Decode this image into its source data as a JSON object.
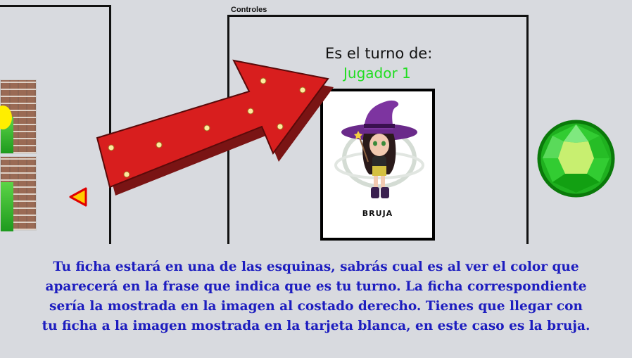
{
  "controls": {
    "title": "Controles",
    "turn_label": "Es el turno de:",
    "current_player": "Jugador 1",
    "player_color": "#22dd22"
  },
  "card": {
    "character": "witch",
    "caption": "BRUJA"
  },
  "board": {
    "nav_icon": "triangle-left-icon",
    "player_token": "green-gem-icon"
  },
  "instructions": {
    "line1": "Tu ficha estará en una de las esquinas, sabrás cual es al ver el color que",
    "line2": "aparecerá en la frase que indica que es tu turno. La ficha correspondiente",
    "line3": "sería la mostrada en la imagen al costado derecho. Tienes que llegar con",
    "line4": "tu ficha a la imagen mostrada en la tarjeta blanca, en este caso es la bruja."
  },
  "colors": {
    "instruction_text": "#1d1dbf",
    "arrow": "#d81e1e",
    "gem": "#22c022",
    "background": "#d8dadf"
  }
}
